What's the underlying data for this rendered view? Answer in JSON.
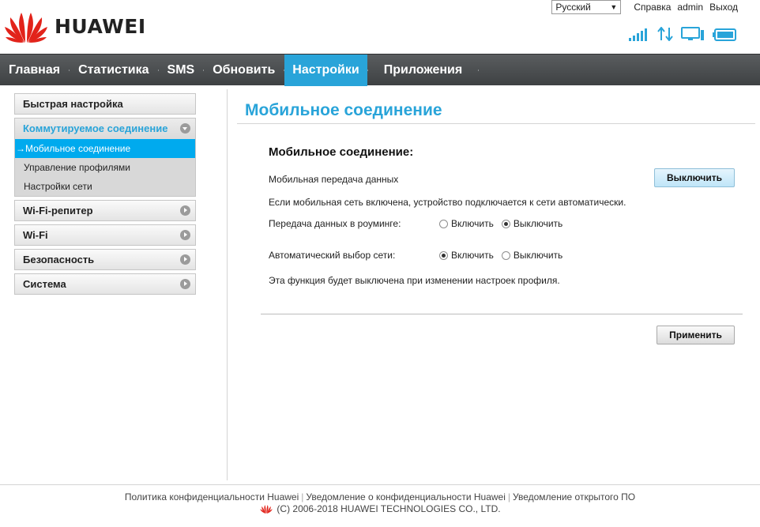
{
  "brand": {
    "name": "HUAWEI",
    "color": "#e2231a"
  },
  "topbar": {
    "language": "Русский",
    "help": "Справка",
    "user": "admin",
    "logout": "Выход"
  },
  "status_icons": [
    "signal-strength-icon",
    "data-transfer-icon",
    "connection-monitor-icon",
    "battery-icon"
  ],
  "nav": {
    "items": [
      {
        "label": "Главная"
      },
      {
        "label": "Статистика"
      },
      {
        "label": "SMS"
      },
      {
        "label": "Обновить"
      },
      {
        "label": "Настройки",
        "active": true
      },
      {
        "label": "Приложения"
      }
    ]
  },
  "sidebar": {
    "quick_setup": "Быстрая настройка",
    "dialup": {
      "title": "Коммутируемое соединение",
      "items": [
        "Мобильное соединение",
        "Управление профилями",
        "Настройки сети"
      ],
      "active_index": 0,
      "active_marker": "→"
    },
    "wifi_repeater": "Wi-Fi-репитер",
    "wifi": "Wi-Fi",
    "security": "Безопасность",
    "system": "Система"
  },
  "main": {
    "title": "Мобильное соединение",
    "section_title": "Мобильное соединение:",
    "mobile_data_label": "Мобильная передача данных",
    "mobile_data_button": "Выключить",
    "auto_connect_note": "Если мобильная сеть включена, устройство подключается к сети автоматически.",
    "roaming": {
      "label": "Передача данных в роуминге:",
      "options": [
        "Включить",
        "Выключить"
      ],
      "selected": 1
    },
    "auto_network": {
      "label": "Автоматический выбор сети:",
      "options": [
        "Включить",
        "Выключить"
      ],
      "selected": 0
    },
    "profile_note": "Эта функция будет выключена при изменении настроек профиля.",
    "apply_button": "Применить"
  },
  "footer": {
    "links": [
      "Политика конфиденциальности Huawei",
      "Уведомление о конфиденциальности Huawei",
      "Уведомление открытого ПО"
    ],
    "copyright": "(C) 2006-2018 HUAWEI TECHNOLOGIES CO., LTD."
  },
  "colors": {
    "accent": "#29a4d9",
    "nav_bg": "#4a4d50",
    "active_sub": "#00aaee"
  }
}
